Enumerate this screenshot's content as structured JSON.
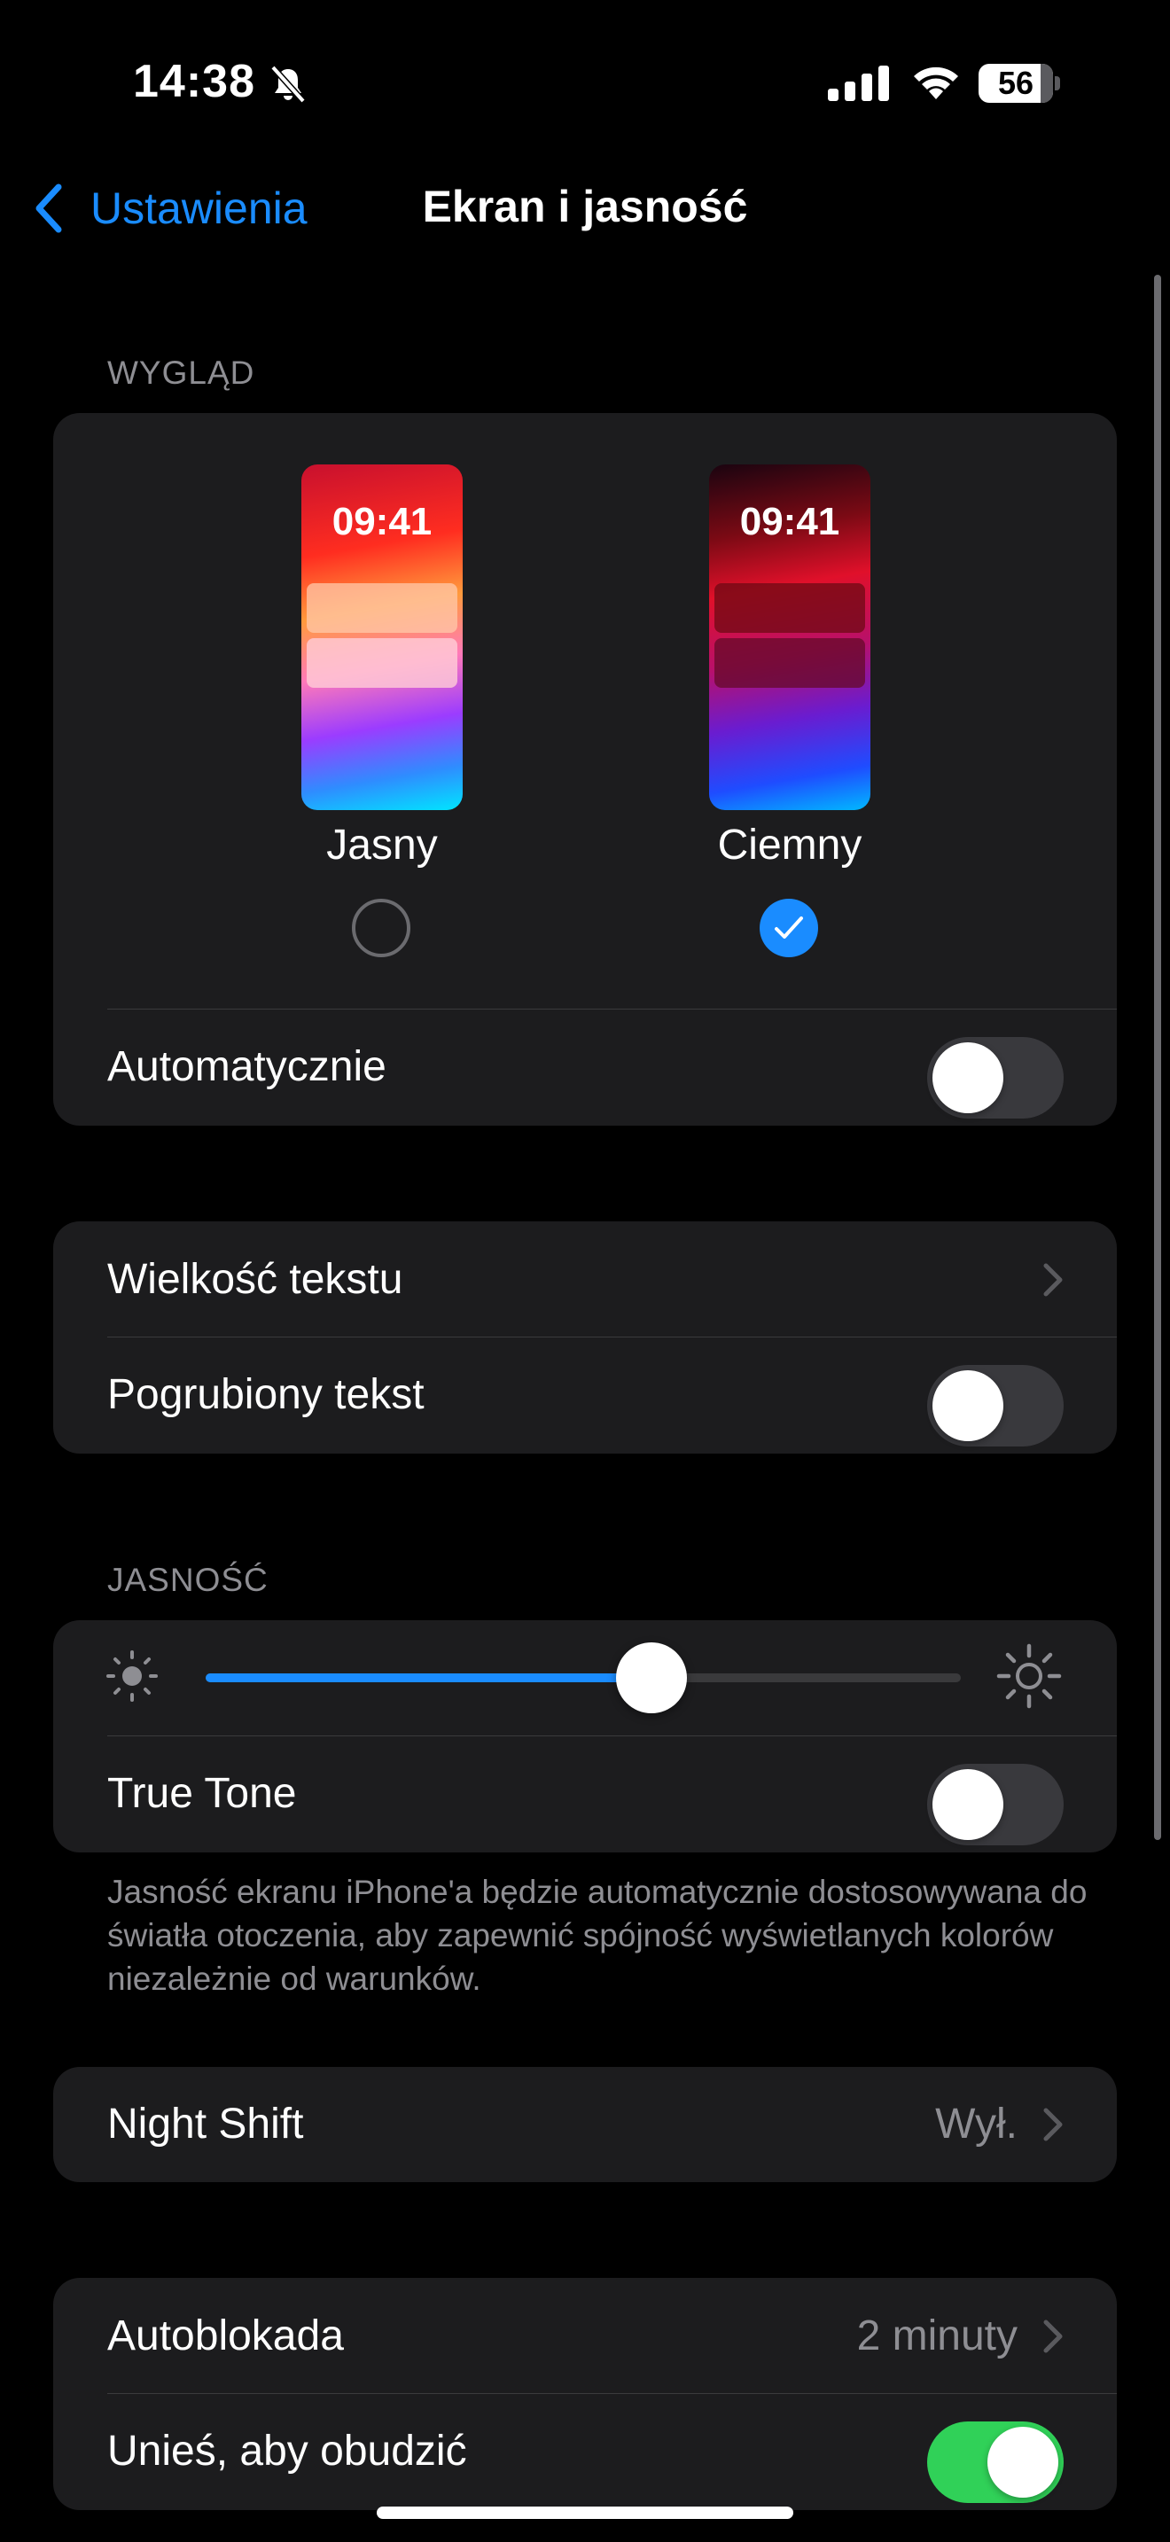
{
  "status_bar": {
    "time": "14:38",
    "battery": "56",
    "icons": [
      "bell-slash-icon",
      "signal-icon",
      "wifi-icon",
      "battery-icon"
    ]
  },
  "nav": {
    "back_label": "Ustawienia",
    "title": "Ekran i jasność"
  },
  "appearance": {
    "header": "WYGLĄD",
    "options": [
      {
        "label": "Jasny",
        "preview_time": "09:41",
        "selected": false
      },
      {
        "label": "Ciemny",
        "preview_time": "09:41",
        "selected": true
      }
    ],
    "automatic_label": "Automatycznie",
    "automatic_on": false
  },
  "text": {
    "text_size_label": "Wielkość tekstu",
    "bold_text_label": "Pogrubiony tekst",
    "bold_text_on": false
  },
  "brightness": {
    "header": "JASNOŚĆ",
    "level": 0.59,
    "true_tone_label": "True Tone",
    "true_tone_on": false,
    "footer": "Jasność ekranu iPhone'a będzie automatycznie dostosowywana do światła otoczenia, aby zapewnić spójność wyświetlanych kolorów niezależnie od warunków."
  },
  "night_shift": {
    "label": "Night Shift",
    "value": "Wył."
  },
  "lock": {
    "auto_lock_label": "Autoblokada",
    "auto_lock_value": "2 minuty",
    "raise_to_wake_label": "Unieś, aby obudzić",
    "raise_to_wake_on": true
  },
  "colors": {
    "accent": "#1a8cff",
    "toggle_on": "#30d158",
    "card_bg": "#1c1c1e",
    "secondary_text": "#8e8e93"
  }
}
